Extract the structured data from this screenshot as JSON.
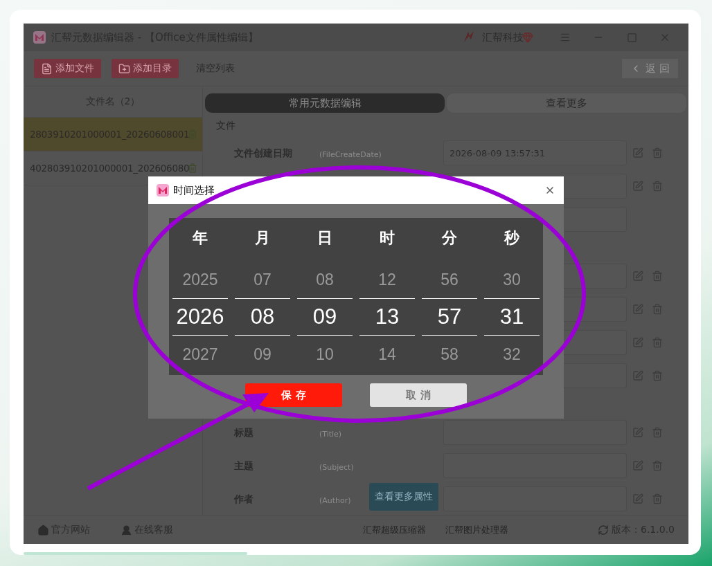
{
  "window": {
    "title": "汇帮元数据编辑器 - 【Office文件属性编辑】",
    "brand": "汇帮科技"
  },
  "toolbar": {
    "buttons": [
      {
        "label": "添加文件",
        "kind": "file"
      },
      {
        "label": "添加目录",
        "kind": "folder"
      },
      {
        "label": "清空列表",
        "kind": "text"
      }
    ],
    "back": "返 回"
  },
  "file_list": {
    "header": "文件名（2）",
    "files": [
      {
        "name": "2803910201000001_20260608001",
        "selected": true
      },
      {
        "name": "402803910201000001_202606080",
        "selected": false
      }
    ]
  },
  "tabs": [
    {
      "label": "常用元数据编辑",
      "selected": true
    },
    {
      "label": "查看更多",
      "selected": false
    }
  ],
  "sections": [
    {
      "title": "文件",
      "rows": [
        {
          "label": "文件创建日期",
          "hint": "(FileCreateDate)",
          "value": "2026-08-09 13:57:31",
          "actions": true
        },
        {
          "actions": true
        },
        {
          "actions": false
        }
      ]
    },
    {
      "rows": [
        {
          "actions": true
        },
        {
          "actions": true
        },
        {
          "actions": true
        },
        {
          "actions": true
        }
      ]
    },
    {
      "rows": [
        {
          "label": "标题",
          "hint": "(Title)",
          "actions": true
        },
        {
          "label": "主题",
          "hint": "(Subject)",
          "actions": true
        },
        {
          "label": "作者",
          "hint": "(Author)",
          "actions": true
        }
      ]
    }
  ],
  "more_button": "查看更多属性",
  "status_bar": {
    "links": [
      {
        "label": "官方网站",
        "kind": "home"
      },
      {
        "label": "在线客服",
        "kind": "support"
      }
    ],
    "apps": [
      "汇帮超级压缩器",
      "汇帮图片处理器"
    ],
    "version": "版本：6.1.0.0"
  },
  "dialog": {
    "title": "时间选择",
    "columns": [
      {
        "label": "年",
        "options": [
          {
            "text": "2025",
            "selected": false
          },
          {
            "text": "2026",
            "selected": true
          },
          {
            "text": "2027",
            "selected": false
          }
        ]
      },
      {
        "label": "月",
        "options": [
          {
            "text": "07",
            "selected": false
          },
          {
            "text": "08",
            "selected": true
          },
          {
            "text": "09",
            "selected": false
          }
        ]
      },
      {
        "label": "日",
        "options": [
          {
            "text": "08",
            "selected": false
          },
          {
            "text": "09",
            "selected": true
          },
          {
            "text": "10",
            "selected": false
          }
        ]
      },
      {
        "label": "时",
        "options": [
          {
            "text": "12",
            "selected": false
          },
          {
            "text": "13",
            "selected": true
          },
          {
            "text": "14",
            "selected": false
          }
        ]
      },
      {
        "label": "分",
        "options": [
          {
            "text": "56",
            "selected": false
          },
          {
            "text": "57",
            "selected": true
          },
          {
            "text": "58",
            "selected": false
          }
        ]
      },
      {
        "label": "秒",
        "options": [
          {
            "text": "30",
            "selected": false
          },
          {
            "text": "31",
            "selected": true
          },
          {
            "text": "32",
            "selected": false
          }
        ]
      }
    ],
    "buttons": [
      {
        "label": "保 存",
        "kind": "confirm"
      },
      {
        "label": "取 消",
        "kind": "cancel"
      }
    ]
  }
}
